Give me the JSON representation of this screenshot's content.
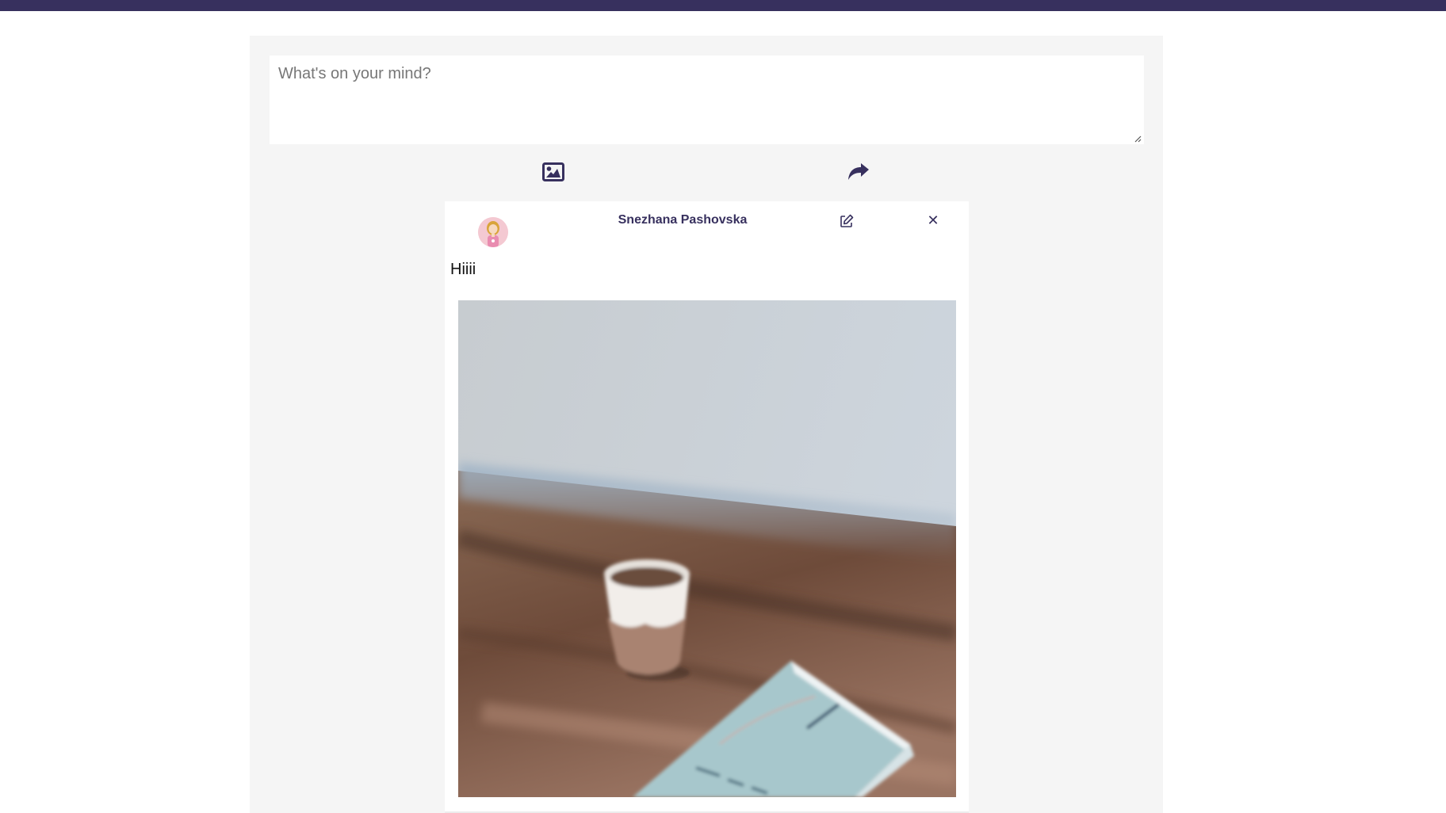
{
  "colors": {
    "brand": "#37305e",
    "panel_bg": "#f5f5f5",
    "card_bg": "#ffffff"
  },
  "composer": {
    "placeholder": "What's on your mind?",
    "value": ""
  },
  "actions": {
    "image_icon": "image-icon",
    "share_icon": "share-icon"
  },
  "post": {
    "author": "Snezhana Pashovska",
    "text": "Hiiii",
    "edit_icon": "edit-icon",
    "close_symbol": "✕",
    "photo_alt": "Photo attached to post"
  }
}
